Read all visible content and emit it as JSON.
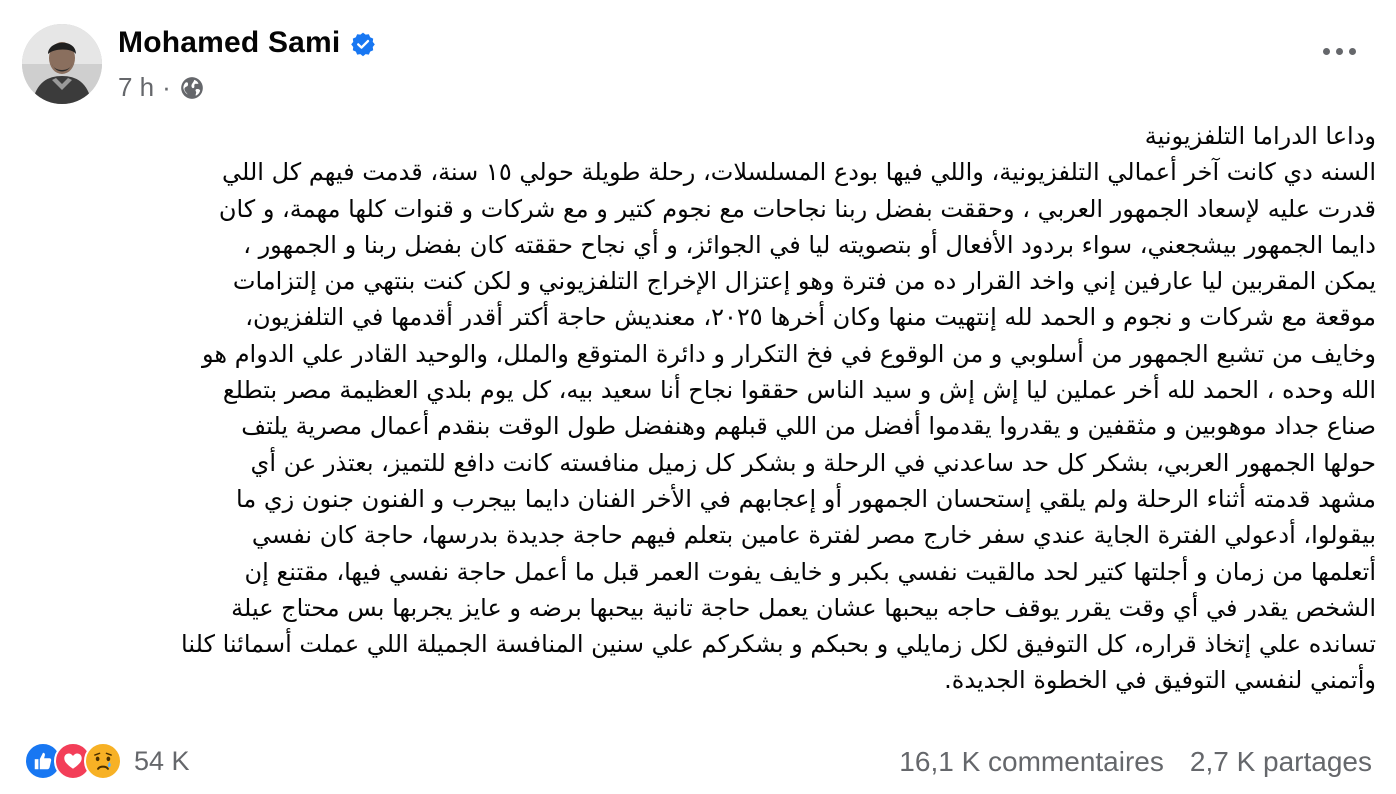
{
  "header": {
    "author_name": "Mohamed Sami",
    "time": "7 h",
    "verified_icon": "verified-badge-icon",
    "audience_icon": "globe-icon",
    "more_icon": "more-options-icon"
  },
  "post": {
    "lines": [
      "وداعا الدراما التلفزيونية",
      "السنه دي كانت آخر أعمالي التلفزيونية، واللي فيها بودع المسلسلات، رحلة طويلة حولي ١٥ سنة، قدمت فيهم كل اللي",
      "قدرت عليه لإسعاد الجمهور العربي ، وحققت بفضل ربنا نجاحات مع نجوم كتير و مع شركات و قنوات كلها مهمة، و كان",
      "دايما الجمهور بيشجعني، سواء بردود الأفعال أو بتصويته ليا في الجوائز، و أي نجاح حققته كان بفضل ربنا و الجمهور ،",
      "يمكن المقربين ليا عارفين إني واخد القرار ده من فترة وهو إعتزال الإخراج التلفزيوني و لكن كنت بنتهي من إلتزامات",
      "موقعة مع شركات و نجوم و الحمد لله إنتهيت منها وكان أخرها ٢٠٢٥، معنديش حاجة أكتر أقدر أقدمها في التلفزيون،",
      "وخايف من تشبع الجمهور من أسلوبي و من الوقوع في فخ التكرار و دائرة المتوقع والملل، والوحيد القادر علي الدوام هو",
      "الله وحده ، الحمد لله أخر عملين ليا إش إش و سيد الناس حققوا نجاح أنا سعيد بيه، كل يوم بلدي العظيمة مصر بتطلع",
      "صناع جداد موهوبين و مثقفين و يقدروا يقدموا أفضل من اللي قبلهم وهنفضل طول الوقت بنقدم أعمال مصرية يلتف",
      "حولها الجمهور العربي، بشكر كل حد ساعدني في الرحلة و بشكر كل زميل منافسته كانت دافع للتميز، بعتذر عن أي",
      "مشهد قدمته أثناء الرحلة ولم يلقي إستحسان الجمهور أو إعجابهم في الأخر الفنان دايما بيجرب و الفنون جنون زي ما",
      "بيقولوا، أدعولي الفترة الجاية عندي سفر خارج مصر لفترة عامين بتعلم فيهم حاجة جديدة بدرسها، حاجة كان نفسي",
      "أتعلمها من زمان و أجلتها كتير لحد مالقيت نفسي بكبر و خايف يفوت العمر قبل ما أعمل حاجة نفسي فيها، مقتنع إن",
      "الشخص يقدر في أي وقت يقرر يوقف حاجه بيحبها عشان يعمل حاجة تانية بيحبها برضه و عايز يجربها بس محتاج عيلة",
      "تسانده علي إتخاذ قراره، كل التوفيق لكل زمايلي و بحبكم و بشكركم علي سنين المنافسة الجميلة اللي عملت أسمائنا كلنا",
      "وأتمني لنفسي التوفيق في الخطوة الجديدة."
    ]
  },
  "footer": {
    "reaction_icons": [
      "like-icon",
      "love-icon",
      "sad-icon"
    ],
    "reaction_count": "54 K",
    "comments": "16,1 K commentaires",
    "shares": "2,7 K partages"
  },
  "colors": {
    "text": "#050505",
    "secondary": "#65676b",
    "like": "#1877f2",
    "love": "#f33e58",
    "sad": "#f7b125",
    "verified": "#1877f2"
  }
}
